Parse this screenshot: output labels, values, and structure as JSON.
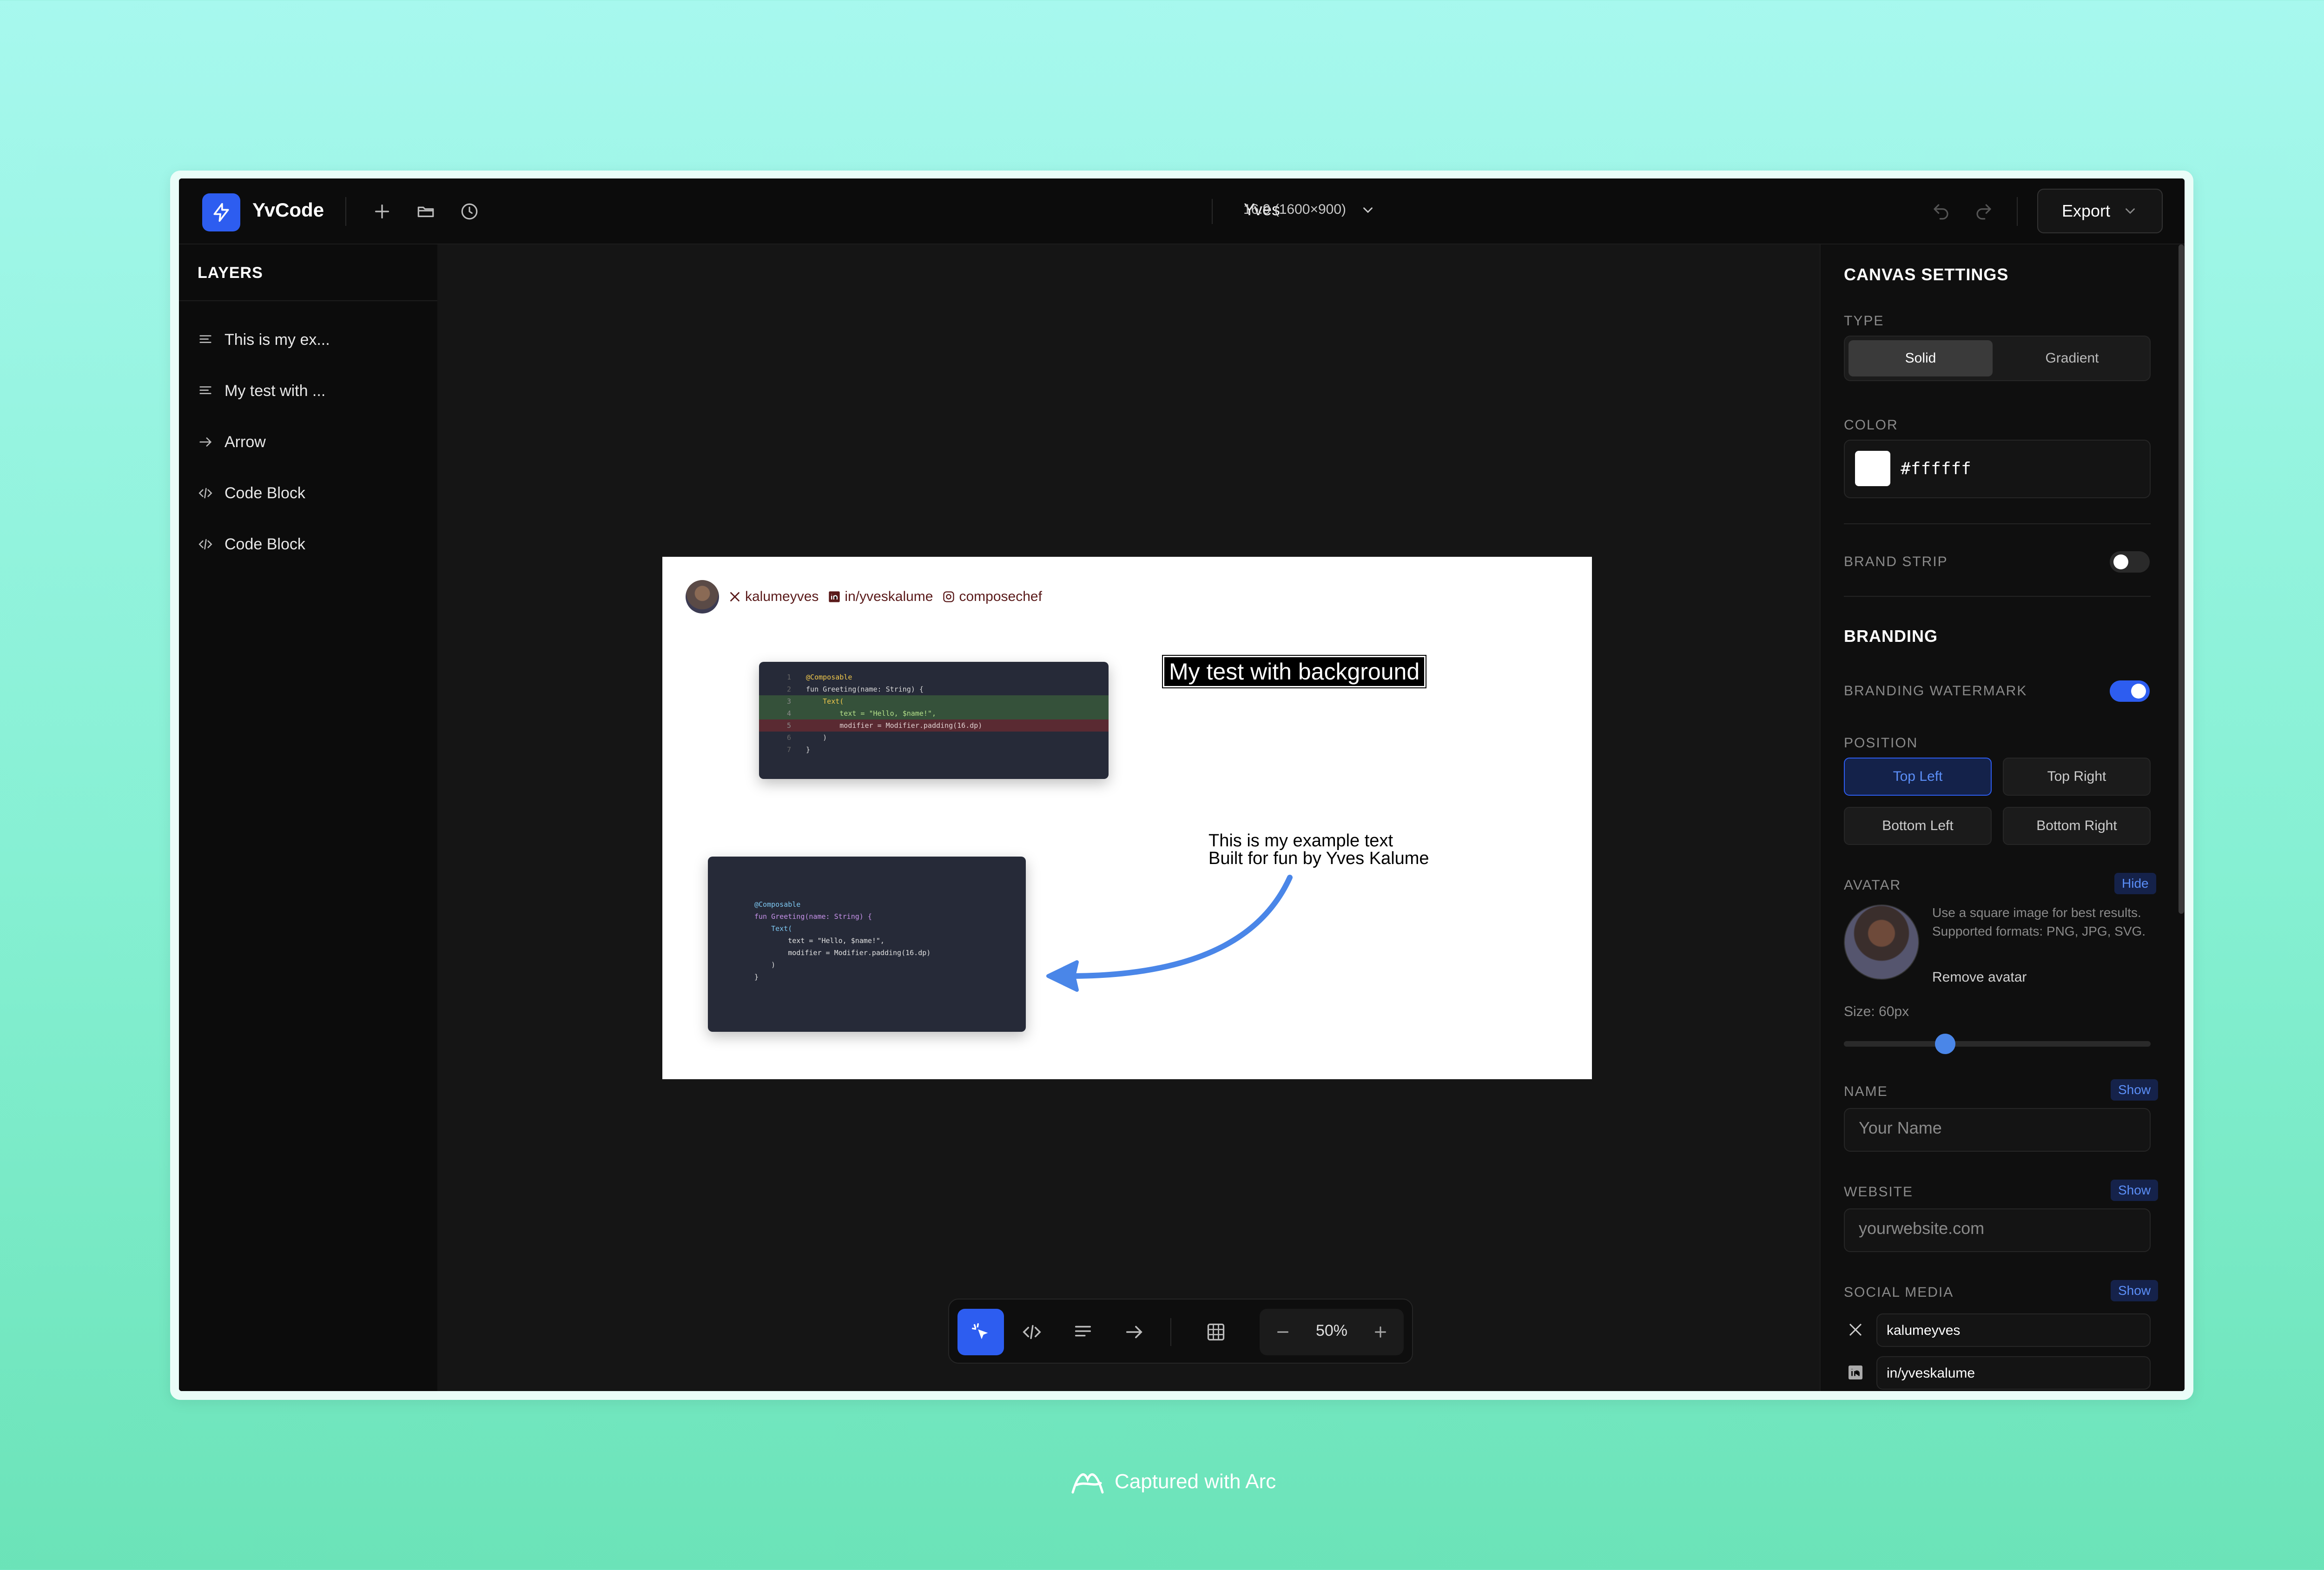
{
  "app": {
    "name": "YvCode",
    "doc_title": "Yves",
    "aspect": "16:9 (1600×900)",
    "export_label": "Export"
  },
  "layers": {
    "title": "LAYERS",
    "items": [
      {
        "icon": "text-icon",
        "label": "This is my ex..."
      },
      {
        "icon": "text-icon",
        "label": "My test with ..."
      },
      {
        "icon": "arrow-icon",
        "label": "Arrow"
      },
      {
        "icon": "code-icon",
        "label": "Code Block"
      },
      {
        "icon": "code-icon",
        "label": "Code Block"
      }
    ]
  },
  "canvas": {
    "social": {
      "x": "kalumeyves",
      "linkedin": "in/yveskalume",
      "instagram": "composechef"
    },
    "highlight_text": "My test with background",
    "multi_text": {
      "line1": "This is my example text",
      "line2": "Built for fun by Yves Kalume"
    },
    "code1": [
      {
        "n": "1",
        "t": "@Composable"
      },
      {
        "n": "2",
        "t": "fun Greeting(name: String) {"
      },
      {
        "n": "3",
        "t": "    Text("
      },
      {
        "n": "4",
        "t": "        text = \"Hello, $name!\","
      },
      {
        "n": "5",
        "t": "        modifier = Modifier.padding(16.dp)"
      },
      {
        "n": "6",
        "t": "    )"
      },
      {
        "n": "7",
        "t": "}"
      }
    ],
    "code2": [
      "@Composable",
      "fun Greeting(name: String) {",
      "    Text(",
      "        text = \"Hello, $name!\",",
      "        modifier = Modifier.padding(16.dp)",
      "    )",
      "}"
    ]
  },
  "toolbar": {
    "zoom": "50%"
  },
  "settings": {
    "canvas_title": "CANVAS SETTINGS",
    "type_label": "TYPE",
    "type_options": [
      "Solid",
      "Gradient"
    ],
    "type_selected": "Solid",
    "color_label": "COLOR",
    "color_value": "#ffffff",
    "brand_strip_label": "BRAND STRIP",
    "brand_strip_on": false,
    "branding_title": "BRANDING",
    "watermark_label": "BRANDING WATERMARK",
    "watermark_on": true,
    "position_label": "POSITION",
    "positions": [
      "Top Left",
      "Top Right",
      "Bottom Left",
      "Bottom Right"
    ],
    "position_selected": "Top Left",
    "avatar_label": "AVATAR",
    "avatar_toggle": "Hide",
    "avatar_help": "Use a square image for best results. Supported formats: PNG, JPG, SVG.",
    "remove_avatar": "Remove avatar",
    "size_label": "Size: 60px",
    "size_value": 0.33,
    "name_label": "NAME",
    "name_toggle": "Show",
    "name_placeholder": "Your Name",
    "website_label": "WEBSITE",
    "website_toggle": "Show",
    "website_placeholder": "yourwebsite.com",
    "social_label": "SOCIAL MEDIA",
    "social_toggle": "Show",
    "social_x": "kalumeyves",
    "social_linkedin": "in/yveskalume"
  },
  "colors": {
    "accent": "#2d5df0",
    "app_bg": "#151515",
    "panel_bg": "#0c0c0c",
    "arrow": "#4a86e8"
  },
  "footer": {
    "text": "Captured with Arc"
  }
}
